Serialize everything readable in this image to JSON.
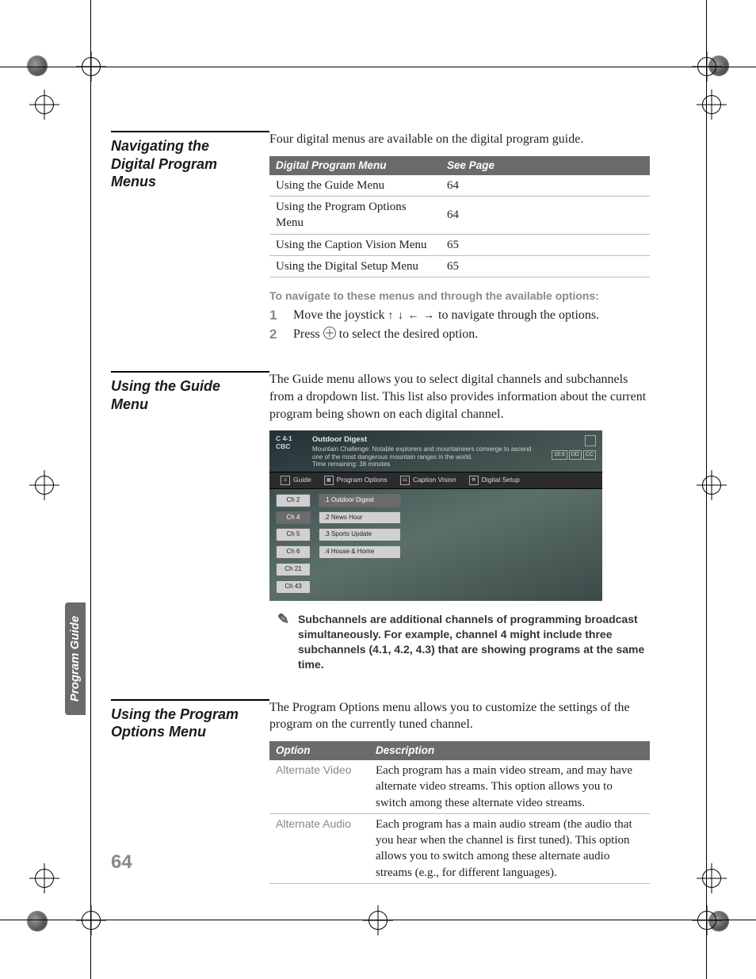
{
  "page_number": "64",
  "side_tab": "Program Guide",
  "section1": {
    "heading": "Navigating the Digital Program Menus",
    "intro": "Four digital menus are available on the digital program guide.",
    "table_headers": {
      "c1": "Digital Program Menu",
      "c2": "See Page"
    },
    "rows": [
      {
        "name": "Using the Guide Menu",
        "page": "64"
      },
      {
        "name": "Using the Program Options Menu",
        "page": "64"
      },
      {
        "name": "Using the Caption Vision Menu",
        "page": "65"
      },
      {
        "name": "Using the Digital Setup Menu",
        "page": "65"
      }
    ],
    "nav_lead": "To navigate to these menus and through the available options:",
    "step1_pre": "Move the joystick ",
    "step1_post": " to navigate through the options.",
    "step2_pre": "Press ",
    "step2_post": " to select the desired option."
  },
  "section2": {
    "heading": "Using the Guide Menu",
    "para": "The Guide menu allows you to select digital channels and subchannels from a dropdown list. This list also provides information about the current program being shown on each digital channel.",
    "tv": {
      "ch_num": "C 4-1",
      "ch_call": "CBC",
      "prog_title": "Outdoor Digest",
      "prog_desc": "Mountain Challenge: Notable explorers and mountaineers converge to ascend one of the most dangerous mountain ranges in the world.",
      "prog_time": "Time remaining: 38 minutes",
      "badges": {
        "b1": "16:9",
        "b2": "DD",
        "b3": "CC"
      },
      "tabs": {
        "t1": "Guide",
        "t2": "Program Options",
        "t3": "Caption Vision",
        "t4": "Digital Setup"
      },
      "channels": [
        "Ch 2",
        "Ch 4",
        "Ch 5",
        "Ch 6",
        "Ch 21",
        "Ch 43"
      ],
      "subs": [
        ".1 Outdoor Digest",
        ".2 News Hour",
        ".3 Sports Update",
        ".4 House & Home"
      ]
    },
    "note": "Subchannels are additional channels of programming broadcast simultaneously. For example, channel 4 might include three subchannels (4.1, 4.2, 4.3) that are showing programs at the same time."
  },
  "section3": {
    "heading": "Using the Program Options Menu",
    "para": "The Program Options menu allows you to customize the settings of the program on the currently tuned channel.",
    "table_headers": {
      "c1": "Option",
      "c2": "Description"
    },
    "rows": [
      {
        "opt": "Alternate Video",
        "desc": "Each program has a main video stream, and may have alternate video streams. This option allows you to switch among these alternate video streams."
      },
      {
        "opt": "Alternate Audio",
        "desc": "Each program has a main audio stream (the audio that you hear when the channel is first tuned). This option allows you to switch among these alternate audio streams (e.g., for different languages)."
      }
    ]
  }
}
